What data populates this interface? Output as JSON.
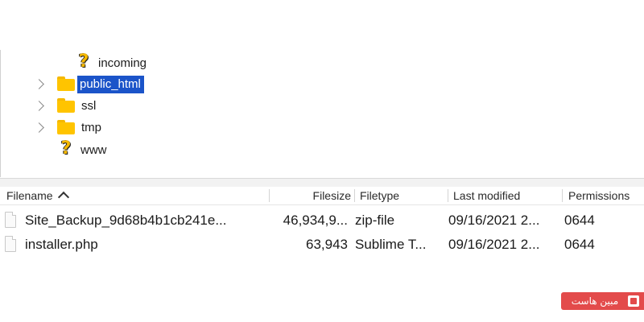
{
  "tree": {
    "items": [
      {
        "label": "incoming",
        "icon": "question-folder-icon",
        "expandable": false,
        "selected": false
      },
      {
        "label": "public_html",
        "icon": "folder-icon",
        "expandable": true,
        "selected": true
      },
      {
        "label": "ssl",
        "icon": "folder-icon",
        "expandable": true,
        "selected": false
      },
      {
        "label": "tmp",
        "icon": "folder-icon",
        "expandable": true,
        "selected": false
      },
      {
        "label": "www",
        "icon": "question-folder-icon",
        "expandable": false,
        "selected": false
      }
    ]
  },
  "file_list": {
    "columns": {
      "filename": "Filename",
      "filesize": "Filesize",
      "filetype": "Filetype",
      "last_modified": "Last modified",
      "permissions": "Permissions"
    },
    "sort": {
      "column": "Filename",
      "direction": "ascending"
    },
    "rows": [
      {
        "filename": "Site_Backup_9d68b4b1cb241e...",
        "filesize": "46,934,9...",
        "filetype": "zip-file",
        "last_modified": "09/16/2021 2...",
        "permissions": "0644"
      },
      {
        "filename": "installer.php",
        "filesize": "63,943",
        "filetype": "Sublime T...",
        "last_modified": "09/16/2021 2...",
        "permissions": "0644"
      }
    ]
  },
  "watermark": {
    "text": "مبین هاست",
    "color": "#e34b4b"
  },
  "colors": {
    "selection": "#1b54c9",
    "folder": "#ffc400"
  }
}
